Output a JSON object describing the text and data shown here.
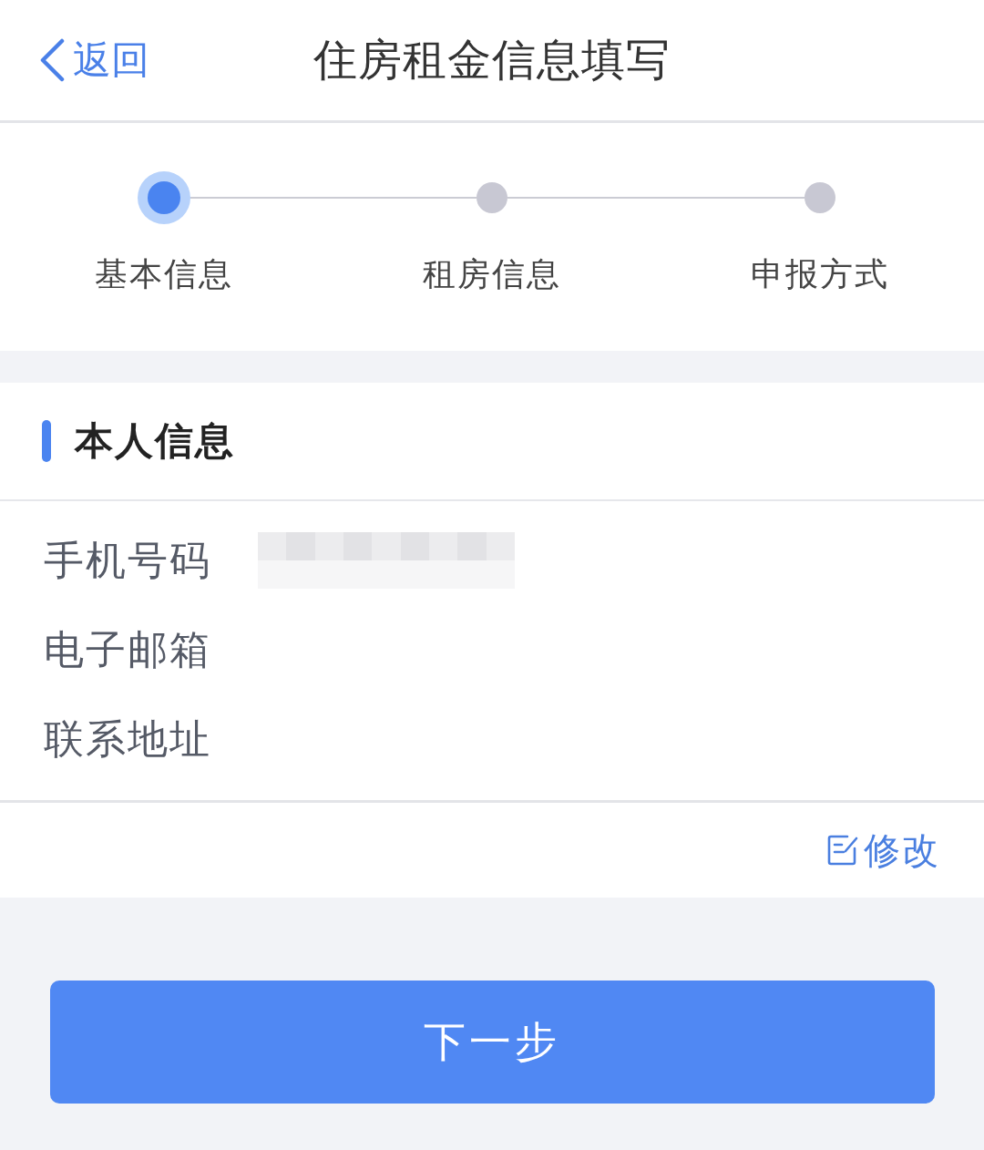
{
  "nav_bar": {
    "back_label": "返回",
    "title": "住房租金信息填写"
  },
  "steps": [
    {
      "label": "基本信息",
      "selected": true
    },
    {
      "label": "租房信息",
      "selected": false
    },
    {
      "label": "申报方式",
      "selected": false
    }
  ],
  "section": {
    "title": "本人信息",
    "fields": [
      {
        "label": "手机号码",
        "redacted": true
      },
      {
        "label": "电子邮箱",
        "redacted": false
      },
      {
        "label": "联系地址",
        "redacted": false
      }
    ],
    "edit_link": "修改"
  },
  "next_button": "下一步"
}
